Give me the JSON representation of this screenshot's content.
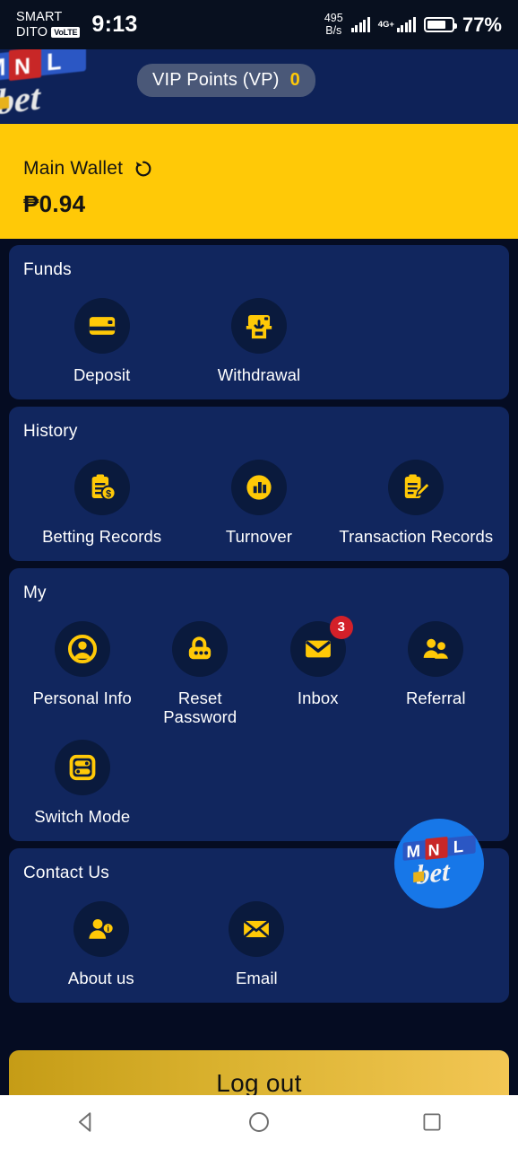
{
  "status_bar": {
    "carrier1": "SMART",
    "carrier2": "DITO",
    "volte_badge": "VoLTE",
    "clock": "9:13",
    "net_speed_value": "495",
    "net_speed_unit": "B/s",
    "network_type": "4G+",
    "battery_percent": "77%"
  },
  "header": {
    "logo_alt": "MNL bet",
    "vip_label": "VIP Points (VP)",
    "vip_value": "0"
  },
  "wallet": {
    "label": "Main Wallet",
    "refresh_icon": "refresh-icon",
    "amount": "₱0.94"
  },
  "sections": [
    {
      "title": "Funds",
      "items": [
        {
          "label": "Deposit",
          "icon": "credit-card-icon"
        },
        {
          "label": "Withdrawal",
          "icon": "cash-withdraw-icon"
        }
      ]
    },
    {
      "title": "History",
      "items": [
        {
          "label": "Betting Records",
          "icon": "clipboard-dollar-icon"
        },
        {
          "label": "Turnover",
          "icon": "bar-chart-icon"
        },
        {
          "label": "Transaction Records",
          "icon": "clipboard-pencil-icon"
        }
      ]
    },
    {
      "title": "My",
      "items": [
        {
          "label": "Personal Info",
          "icon": "user-circle-icon"
        },
        {
          "label": "Reset Password",
          "icon": "lock-icon"
        },
        {
          "label": "Inbox",
          "icon": "envelope-icon",
          "badge": "3"
        },
        {
          "label": "Referral",
          "icon": "users-icon"
        },
        {
          "label": "Switch Mode",
          "icon": "toggle-sliders-icon"
        }
      ]
    },
    {
      "title": "Contact Us",
      "items": [
        {
          "label": "About us",
          "icon": "user-info-icon"
        },
        {
          "label": "Email",
          "icon": "mail-icon"
        }
      ]
    }
  ],
  "logout": {
    "label": "Log out"
  },
  "nav_bar": {
    "back": "back-triangle-icon",
    "home": "home-circle-icon",
    "recents": "recents-square-icon"
  },
  "colors": {
    "page_bg": "#050C22",
    "card_bg": "#11265E",
    "header_bg": "#0E2258",
    "accent_yellow": "#FFC907",
    "badge_red": "#D32029",
    "logo_blue": "#1777E8"
  }
}
